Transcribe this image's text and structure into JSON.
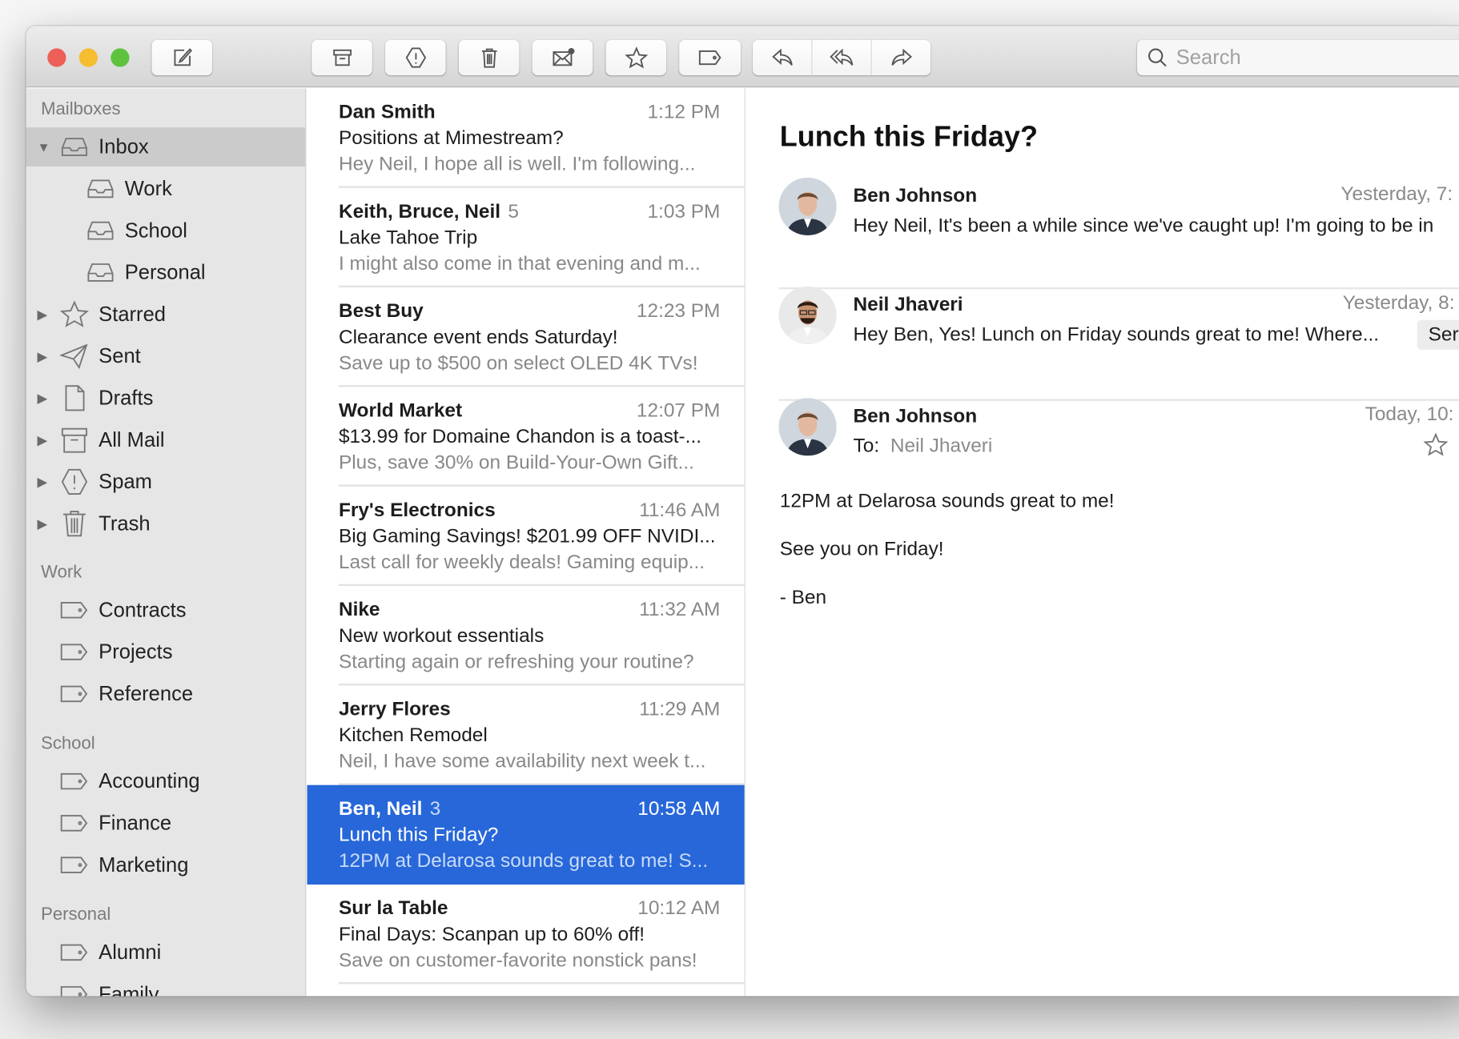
{
  "toolbar": {
    "search_placeholder": "Search",
    "icons": [
      "compose-icon",
      "archive-icon",
      "spam-icon",
      "trash-icon",
      "mark-unread-icon",
      "star-icon",
      "tag-icon",
      "reply-icon",
      "reply-all-icon",
      "forward-icon"
    ]
  },
  "sidebar": {
    "mailboxes_header": "Mailboxes",
    "mailboxes": [
      {
        "label": "Inbox",
        "icon": "inbox-icon",
        "selected": true
      },
      {
        "label": "Work",
        "icon": "inbox-icon"
      },
      {
        "label": "School",
        "icon": "inbox-icon"
      },
      {
        "label": "Personal",
        "icon": "inbox-icon"
      },
      {
        "label": "Starred",
        "icon": "star-icon"
      },
      {
        "label": "Sent",
        "icon": "sent-icon"
      },
      {
        "label": "Drafts",
        "icon": "drafts-icon"
      },
      {
        "label": "All Mail",
        "icon": "archive-icon"
      },
      {
        "label": "Spam",
        "icon": "spam-icon"
      },
      {
        "label": "Trash",
        "icon": "trash-icon"
      }
    ],
    "work_header": "Work",
    "work": [
      "Contracts",
      "Projects",
      "Reference"
    ],
    "school_header": "School",
    "school": [
      "Accounting",
      "Finance",
      "Marketing"
    ],
    "personal_header": "Personal",
    "personal": [
      "Alumni",
      "Family"
    ]
  },
  "messages": [
    {
      "sender": "Dan Smith",
      "count": "",
      "time": "1:12 PM",
      "subject": "Positions at Mimestream?",
      "preview": "Hey Neil, I hope all is well. I'm following..."
    },
    {
      "sender": "Keith, Bruce, Neil",
      "count": "5",
      "time": "1:03 PM",
      "subject": "Lake Tahoe Trip",
      "preview": "I might also come in that evening and m..."
    },
    {
      "sender": "Best Buy",
      "count": "",
      "time": "12:23 PM",
      "subject": "Clearance event ends Saturday!",
      "preview": "Save up to $500 on select OLED 4K TVs!"
    },
    {
      "sender": "World Market",
      "count": "",
      "time": "12:07 PM",
      "subject": "$13.99 for Domaine Chandon is a toast-...",
      "preview": "Plus, save 30% on Build-Your-Own Gift..."
    },
    {
      "sender": "Fry's Electronics",
      "count": "",
      "time": "11:46 AM",
      "subject": "Big Gaming Savings! $201.99 OFF NVIDI...",
      "preview": "Last call for weekly deals! Gaming equip..."
    },
    {
      "sender": "Nike",
      "count": "",
      "time": "11:32 AM",
      "subject": "New workout essentials",
      "preview": "Starting again or refreshing your routine?"
    },
    {
      "sender": "Jerry Flores",
      "count": "",
      "time": "11:29 AM",
      "subject": "Kitchen Remodel",
      "preview": "Neil, I have some availability next week t..."
    },
    {
      "sender": "Ben, Neil",
      "count": "3",
      "time": "10:58 AM",
      "subject": "Lunch this Friday?",
      "preview": "12PM at Delarosa sounds great to me! S...",
      "selected": true
    },
    {
      "sender": "Sur la Table",
      "count": "",
      "time": "10:12 AM",
      "subject": "Final Days: Scanpan up to 60% off!",
      "preview": "Save on customer-favorite nonstick pans!"
    }
  ],
  "thread": {
    "title": "Lunch this Friday?",
    "items": [
      {
        "from": "Ben Johnson",
        "date": "Yesterday, 7:",
        "preview": "Hey Neil, It's been a while since we've caught up! I'm going to be in"
      },
      {
        "from": "Neil Jhaveri",
        "date": "Yesterday, 8:",
        "preview": "Hey Ben, Yes! Lunch on Friday sounds great to me! Where...",
        "badge": "Ser"
      },
      {
        "from": "Ben Johnson",
        "date": "Today, 10:",
        "to_label": "To:",
        "to": "Neil Jhaveri"
      }
    ],
    "body": [
      "12PM at Delarosa sounds great to me!",
      "See you on Friday!",
      "- Ben"
    ]
  },
  "colors": {
    "accent": "#2767d9",
    "close": "#ee5f57",
    "minimize": "#f5bd2f",
    "zoom": "#5fc23f"
  }
}
